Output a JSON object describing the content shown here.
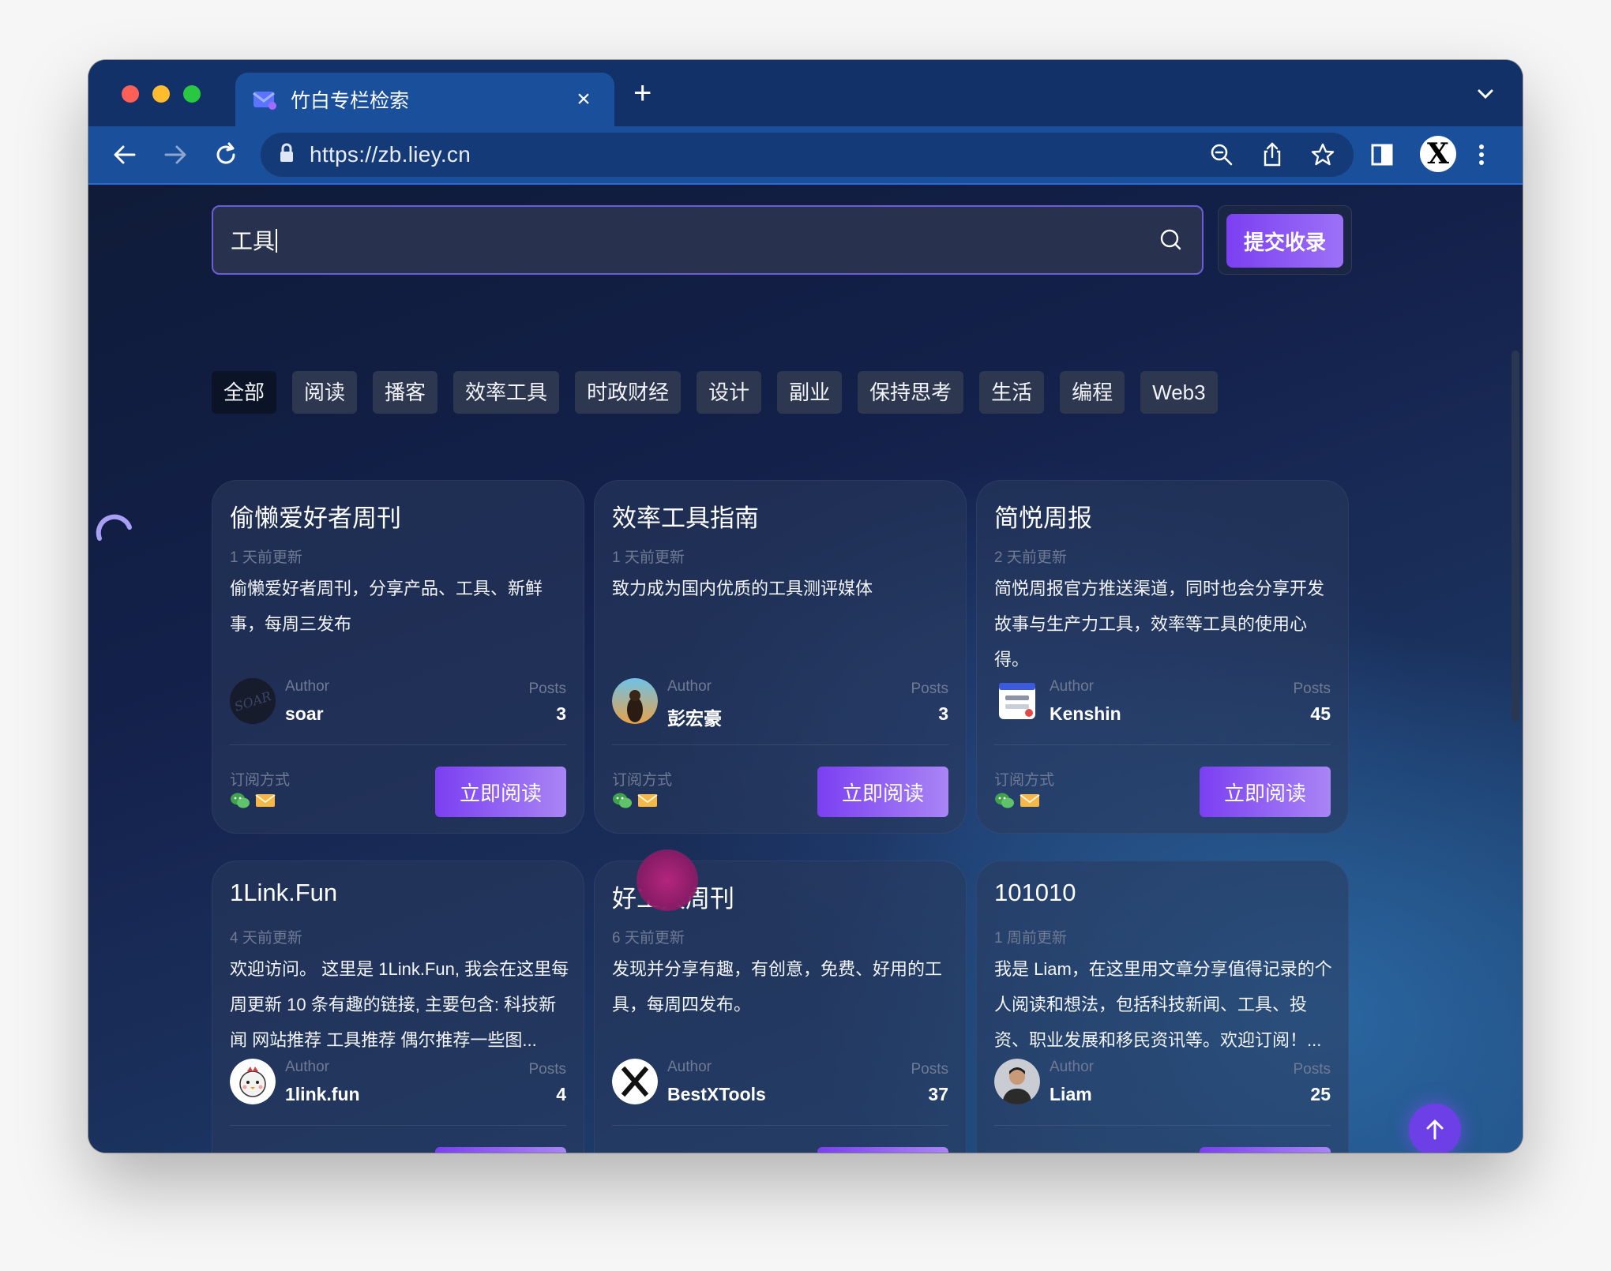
{
  "browser": {
    "tab_title": "竹白专栏检索",
    "tab_close": "×",
    "new_tab": "+",
    "url": "https://zb.liey.cn",
    "profile_letter": "X"
  },
  "search": {
    "value": "工具",
    "submit_label": "提交收录"
  },
  "categories": [
    "全部",
    "阅读",
    "播客",
    "效率工具",
    "时政财经",
    "设计",
    "副业",
    "保持思考",
    "生活",
    "编程",
    "Web3"
  ],
  "active_category": "全部",
  "labels": {
    "author": "Author",
    "posts": "Posts",
    "subscribe": "订阅方式",
    "read_now": "立即阅读"
  },
  "cards": [
    {
      "title": "偷懒爱好者周刊",
      "updated": "1 天前更新",
      "description": "偷懒爱好者周刊，分享产品、工具、新鲜事，每周三发布",
      "author": "soar",
      "posts": "3",
      "avatar": "soar-logo-avatar"
    },
    {
      "title": "效率工具指南",
      "updated": "1 天前更新",
      "description": "致力成为国内优质的工具测评媒体",
      "author": "彭宏豪",
      "posts": "3",
      "avatar": "photo-avatar"
    },
    {
      "title": "简悦周报",
      "updated": "2 天前更新",
      "description": "简悦周报官方推送渠道，同时也会分享开发故事与生产力工具，效率等工具的使用心得。",
      "author": "Kenshin",
      "posts": "45",
      "avatar": "simpread-logo-avatar"
    },
    {
      "title": "1Link.Fun",
      "updated": "4 天前更新",
      "description": "欢迎访问。 这里是 1Link.Fun, 我会在这里每周更新 10 条有趣的链接, 主要包含: 科技新闻 网站推荐 工具推荐 偶尔推荐一些图...",
      "author": "1link.fun",
      "posts": "4",
      "avatar": "chicken-avatar"
    },
    {
      "title": "好工具周刊",
      "updated": "6 天前更新",
      "description": "发现并分享有趣，有创意，免费、好用的工具，每周四发布。",
      "author": "BestXTools",
      "posts": "37",
      "avatar": "x-logo-avatar"
    },
    {
      "title": "101010",
      "updated": "1 周前更新",
      "description": "我是 Liam，在这里用文章分享值得记录的个人阅读和想法，包括科技新闻、工具、投资、职业发展和移民资讯等。欢迎订阅！...",
      "author": "Liam",
      "posts": "25",
      "avatar": "person-photo-avatar"
    }
  ],
  "subscribe_icons": [
    "wechat-icon",
    "mail-icon"
  ],
  "colors": {
    "accent": "#7b3ff2",
    "tabbar": "#123168",
    "toolbar": "#1a4f9c",
    "page_bg": "#13204a"
  }
}
